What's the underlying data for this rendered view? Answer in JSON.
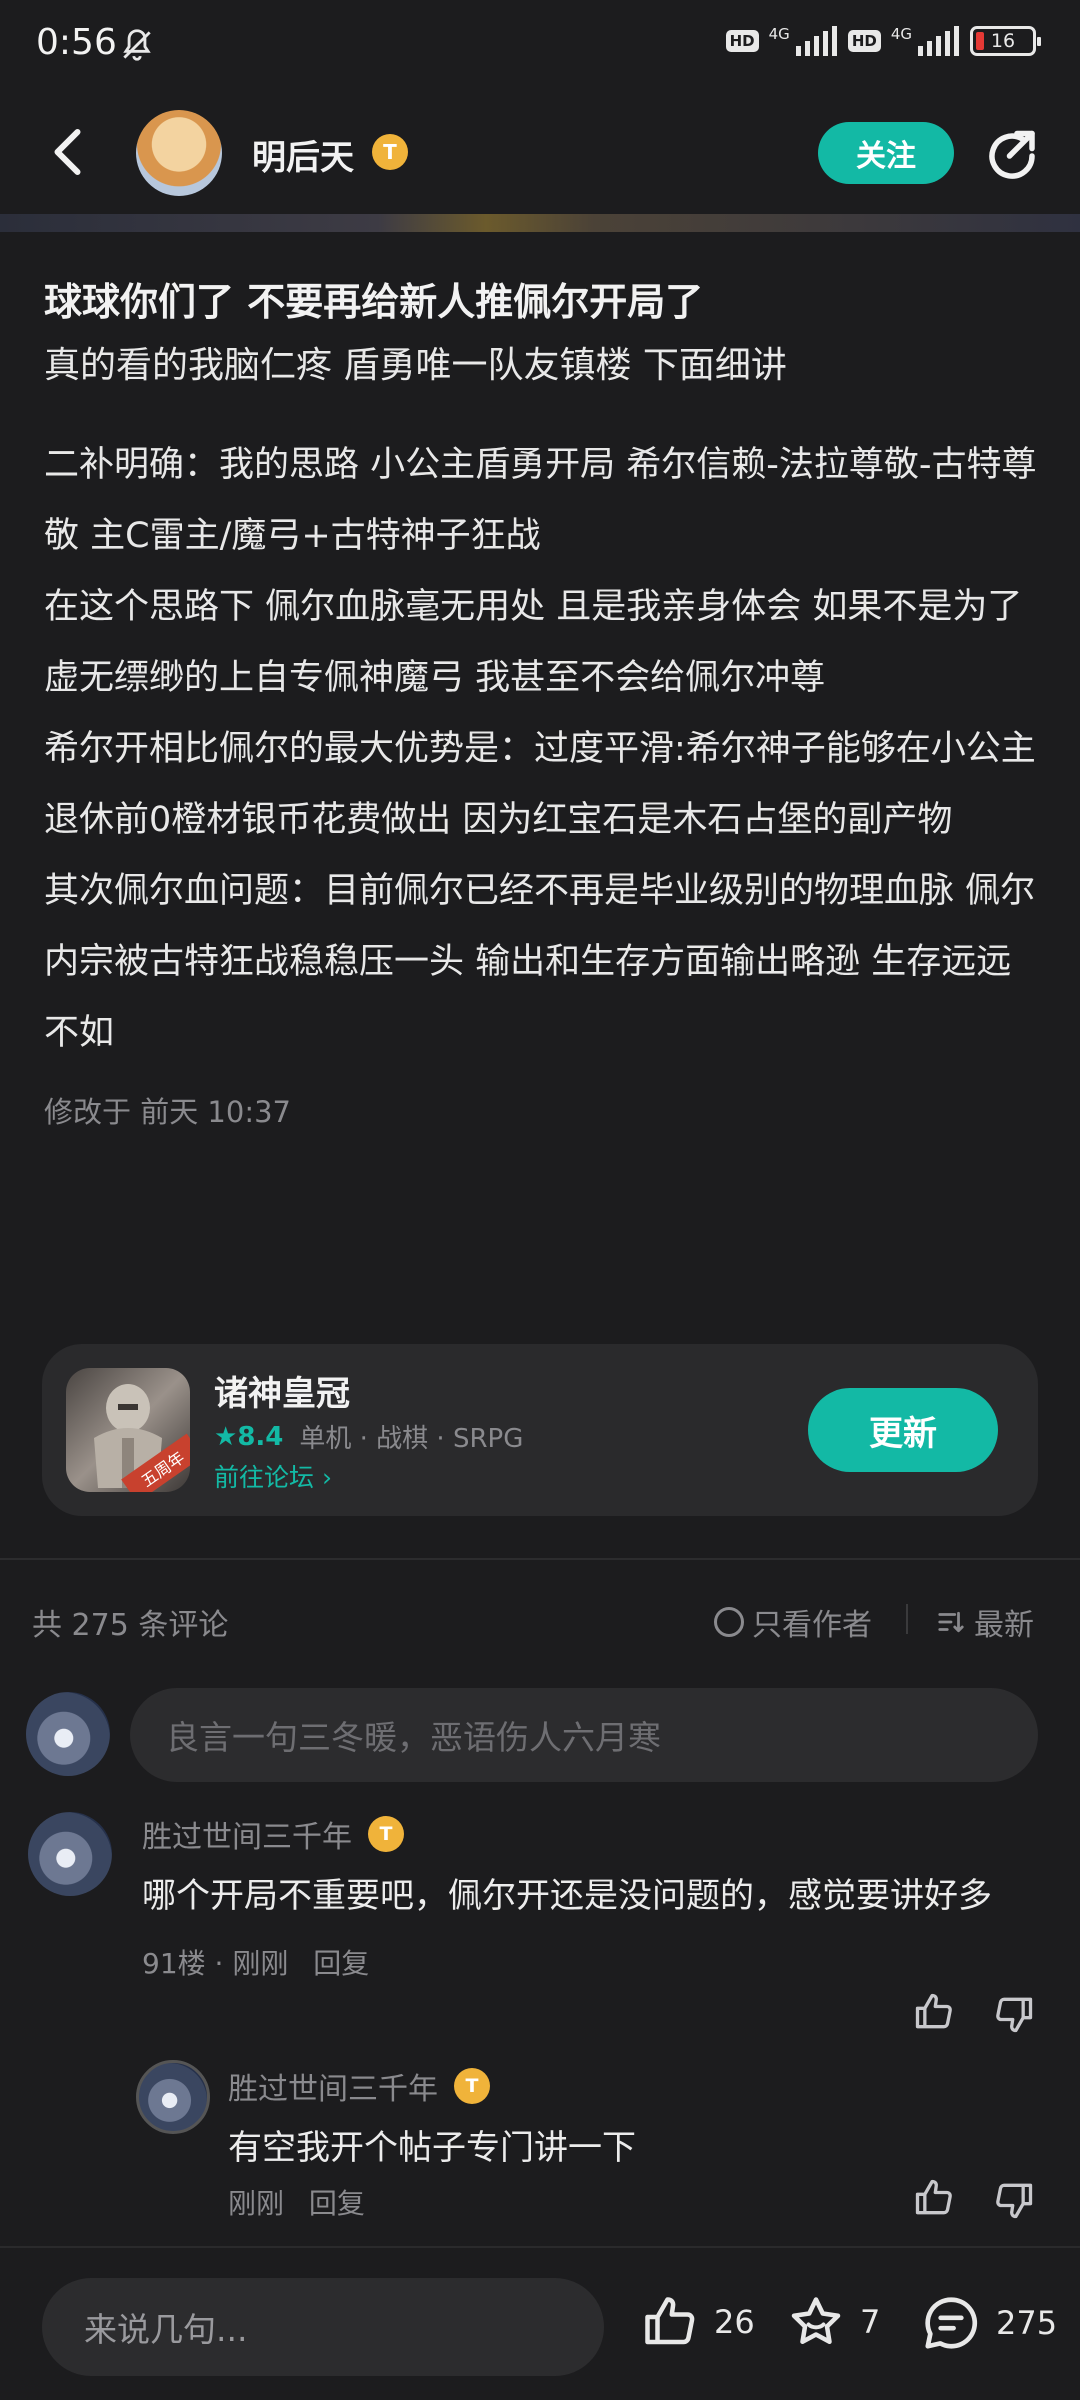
{
  "status": {
    "time": "0:56",
    "net1": "4G",
    "net2": "4G",
    "hd": "HD",
    "battery": "16"
  },
  "header": {
    "author": "明后天",
    "badge": "T",
    "follow_label": "关注"
  },
  "post": {
    "title": "球球你们了 不要再给新人推佩尔开局了",
    "subtitle": "真的看的我脑仁疼  盾勇唯一队友镇楼 下面细讲",
    "paragraphs": [
      "二补明确：我的思路 小公主盾勇开局 希尔信赖-法拉尊敬-古特尊敬 主C雷主/魔弓+古特神子狂战",
      "在这个思路下 佩尔血脉毫无用处 且是我亲身体会 如果不是为了虚无缥缈的上自专佩神魔弓 我甚至不会给佩尔冲尊",
      "希尔开相比佩尔的最大优势是：过度平滑:希尔神子能够在小公主退休前0橙材银币花费做出 因为红宝石是木石占堡的副产物",
      "其次佩尔血问题：目前佩尔已经不再是毕业级别的物理血脉 佩尔内宗被古特狂战稳稳压一头 输出和生存方面输出略逊 生存远远不如"
    ],
    "meta": "修改于 前天 10:37"
  },
  "game": {
    "name": "诸神皇冠",
    "rating": "8.4",
    "tags": "单机 · 战棋 · SRPG",
    "forum": "前往论坛",
    "update_label": "更新",
    "icon_ribbon": "五周年"
  },
  "comments_header": {
    "count": "共 275 条评论",
    "only_author": "只看作者",
    "sort": "最新"
  },
  "comment_input_placeholder": "良言一句三冬暖，恶语伤人六月寒",
  "comments": [
    {
      "name": "胜过世间三千年",
      "badge": "T",
      "text": "哪个开局不重要吧，佩尔开还是没问题的，感觉要讲好多",
      "floor_time": "91楼 · 刚刚",
      "reply": "回复"
    },
    {
      "name": "胜过世间三千年",
      "badge": "T",
      "text": "有空我开个帖子专门讲一下",
      "floor_time": "刚刚",
      "reply": "回复"
    }
  ],
  "bottom_bar": {
    "say_placeholder": "来说几句...",
    "likes": "26",
    "favorites": "7",
    "comments": "275"
  },
  "colors": {
    "accent": "#13b9a5",
    "background": "#1c1c1e",
    "badge": "#f0b33a"
  }
}
